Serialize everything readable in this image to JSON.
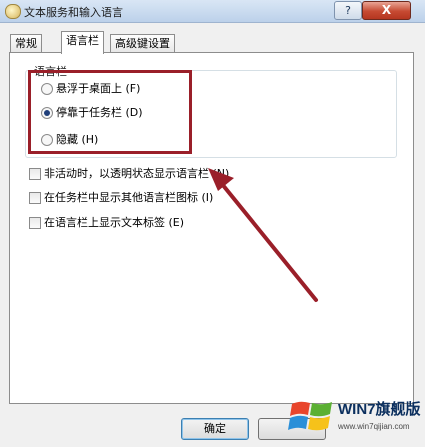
{
  "window": {
    "title": "文本服务和输入语言",
    "help_label": "?",
    "close_label": "X"
  },
  "tabs": [
    {
      "label": "常规",
      "active": false
    },
    {
      "label": "语言栏",
      "active": true
    },
    {
      "label": "高级键设置",
      "active": false
    }
  ],
  "language_bar_group": {
    "title": "语言栏",
    "options": [
      {
        "label": "悬浮于桌面上 (F)",
        "selected": false
      },
      {
        "label": "停靠于任务栏 (D)",
        "selected": true
      },
      {
        "label": "隐藏 (H)",
        "selected": false
      }
    ]
  },
  "checkboxes": [
    {
      "label": "非活动时，以透明状态显示语言栏 (N)",
      "checked": false
    },
    {
      "label": "在任务栏中显示其他语言栏图标 (I)",
      "checked": false
    },
    {
      "label": "在语言栏上显示文本标签 (E)",
      "checked": false
    }
  ],
  "buttons": {
    "ok_label": "确定",
    "cancel_label": ""
  },
  "watermark": {
    "brand": "WIN7旗舰版",
    "url": "www.win7qijian.com"
  },
  "colors": {
    "annotation_red": "#9a1f29",
    "close_red": "#c64a32"
  }
}
